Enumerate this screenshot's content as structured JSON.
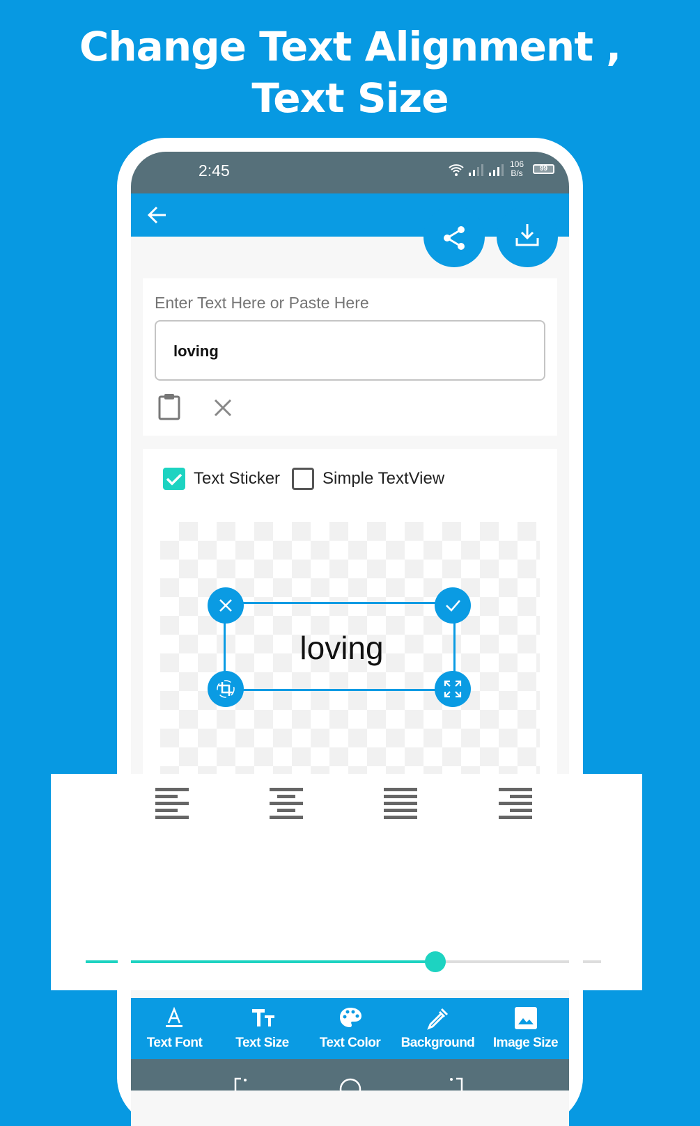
{
  "headline": "Change Text Alignment , Text Size",
  "status_bar": {
    "time": "2:45",
    "net_speed_value": "106",
    "net_speed_unit": "B/s",
    "battery": "99"
  },
  "app_bar": {
    "back_icon": "arrow-left-icon",
    "share_icon": "share-icon",
    "download_icon": "download-icon"
  },
  "input_card": {
    "label": "Enter Text Here or Paste Here",
    "value": "loving",
    "paste_icon": "clipboard-icon",
    "clear_icon": "close-icon"
  },
  "options": {
    "text_sticker": {
      "label": "Text Sticker",
      "checked": true
    },
    "simple_textview": {
      "label": "Simple TextView",
      "checked": false
    }
  },
  "sticker": {
    "text": "loving"
  },
  "alignment": [
    "align-left",
    "align-center",
    "align-justify",
    "align-right"
  ],
  "text_size_slider": {
    "value_fraction": 0.695
  },
  "toolbar": [
    {
      "label": "Text Font",
      "icon": "text-font-icon"
    },
    {
      "label": "Text Size",
      "icon": "text-size-icon"
    },
    {
      "label": "Text Color",
      "icon": "palette-icon"
    },
    {
      "label": "Background",
      "icon": "eyedropper-icon"
    },
    {
      "label": "Image Size",
      "icon": "image-icon"
    }
  ],
  "colors": {
    "brand": "#0a9be3",
    "accent": "#1dd3c1",
    "status_bar": "#56707a"
  }
}
